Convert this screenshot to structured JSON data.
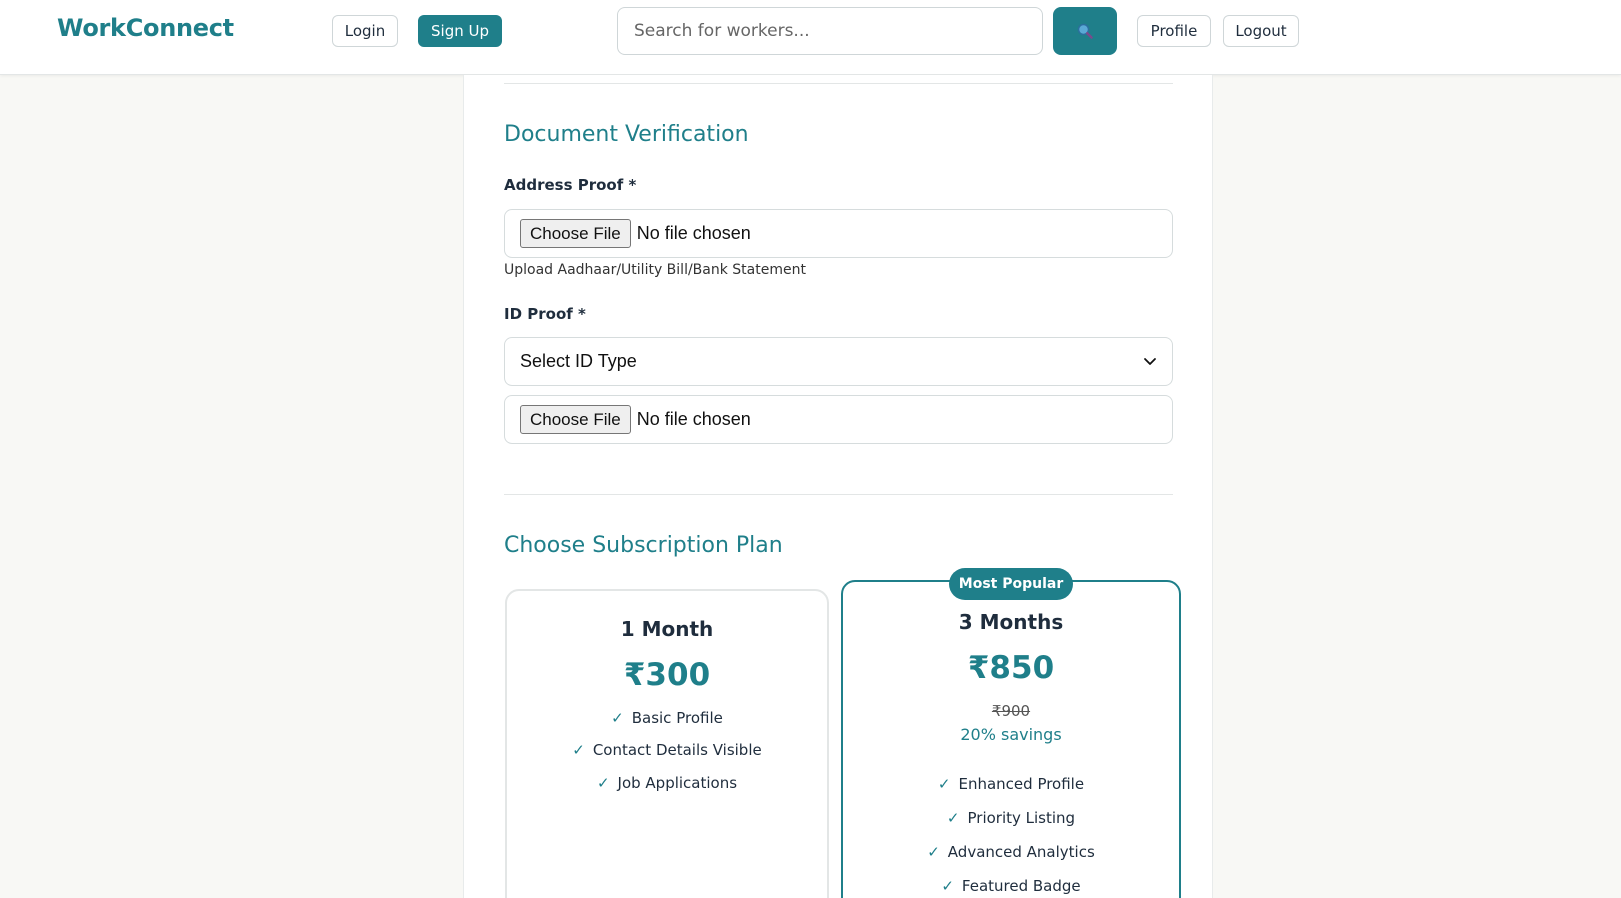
{
  "nav": {
    "brand": "WorkConnect",
    "login_label": "Login",
    "signup_label": "Sign Up",
    "search_placeholder": "Search for workers...",
    "profile_label": "Profile",
    "logout_label": "Logout"
  },
  "documents": {
    "title": "Document Verification",
    "address_label": "Address Proof *",
    "address_file_button": "Choose File",
    "address_file_status": "No file chosen",
    "address_help": "Upload Aadhaar/Utility Bill/Bank Statement",
    "id_label": "ID Proof *",
    "id_select_value": "Select ID Type",
    "id_file_button": "Choose File",
    "id_file_status": "No file chosen"
  },
  "subscription": {
    "title": "Choose Subscription Plan",
    "plans": [
      {
        "name": "1 Month",
        "price": "₹300",
        "features": [
          "Basic Profile",
          "Contact Details Visible",
          "Job Applications"
        ]
      },
      {
        "badge": "Most Popular",
        "name": "3 Months",
        "price": "₹850",
        "old_price": "₹900",
        "savings": "20% savings",
        "features": [
          "Enhanced Profile",
          "Priority Listing",
          "Advanced Analytics",
          "Featured Badge"
        ]
      }
    ]
  },
  "icons": {
    "search": "search-icon",
    "select_arrow": "chevron-down-icon",
    "check": "check-icon"
  },
  "colors": {
    "accent": "#1f7f8a",
    "background": "#f8f8f5"
  }
}
